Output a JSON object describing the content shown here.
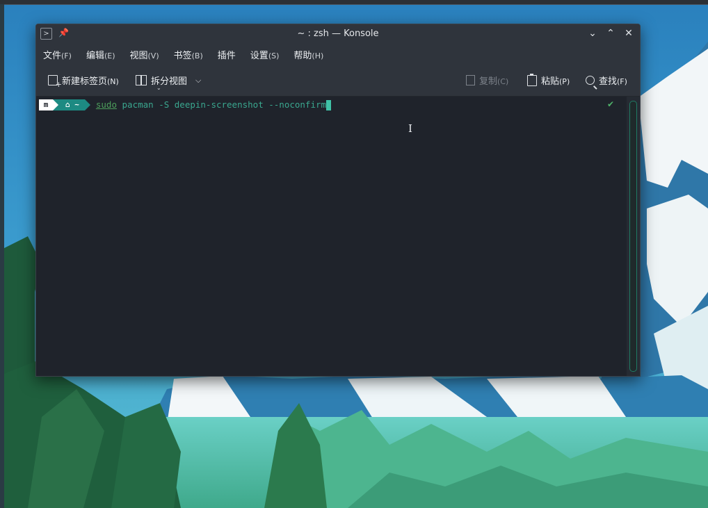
{
  "window": {
    "title": "~ : zsh — Konsole",
    "app_icon": "terminal-icon",
    "pin_icon": "pin-icon"
  },
  "menubar": {
    "items": [
      {
        "label": "文件",
        "accel": "(F)"
      },
      {
        "label": "编辑",
        "accel": "(E)"
      },
      {
        "label": "视图",
        "accel": "(V)"
      },
      {
        "label": "书签",
        "accel": "(B)"
      },
      {
        "label": "插件",
        "accel": ""
      },
      {
        "label": "设置",
        "accel": "(S)"
      },
      {
        "label": "帮助",
        "accel": "(H)"
      }
    ]
  },
  "toolbar": {
    "new_tab": {
      "label": "新建标签页",
      "accel": "(N)"
    },
    "split_view": {
      "label": "拆分视图"
    },
    "copy": {
      "label": "复制",
      "accel": "(C)"
    },
    "paste": {
      "label": "粘贴",
      "accel": "(P)"
    },
    "find": {
      "label": "查找",
      "accel": "(F)"
    }
  },
  "terminal": {
    "prompt_dir": "~",
    "cmd_sudo": "sudo",
    "cmd_program": "pacman",
    "cmd_args": "-S deepin-screenshot --noconfirm",
    "status_mark": "✔"
  },
  "colors": {
    "accent": "#1d8a82",
    "cursor": "#3fc1a6",
    "window_bg": "#1f232b",
    "chrome_bg": "#2f343c"
  }
}
